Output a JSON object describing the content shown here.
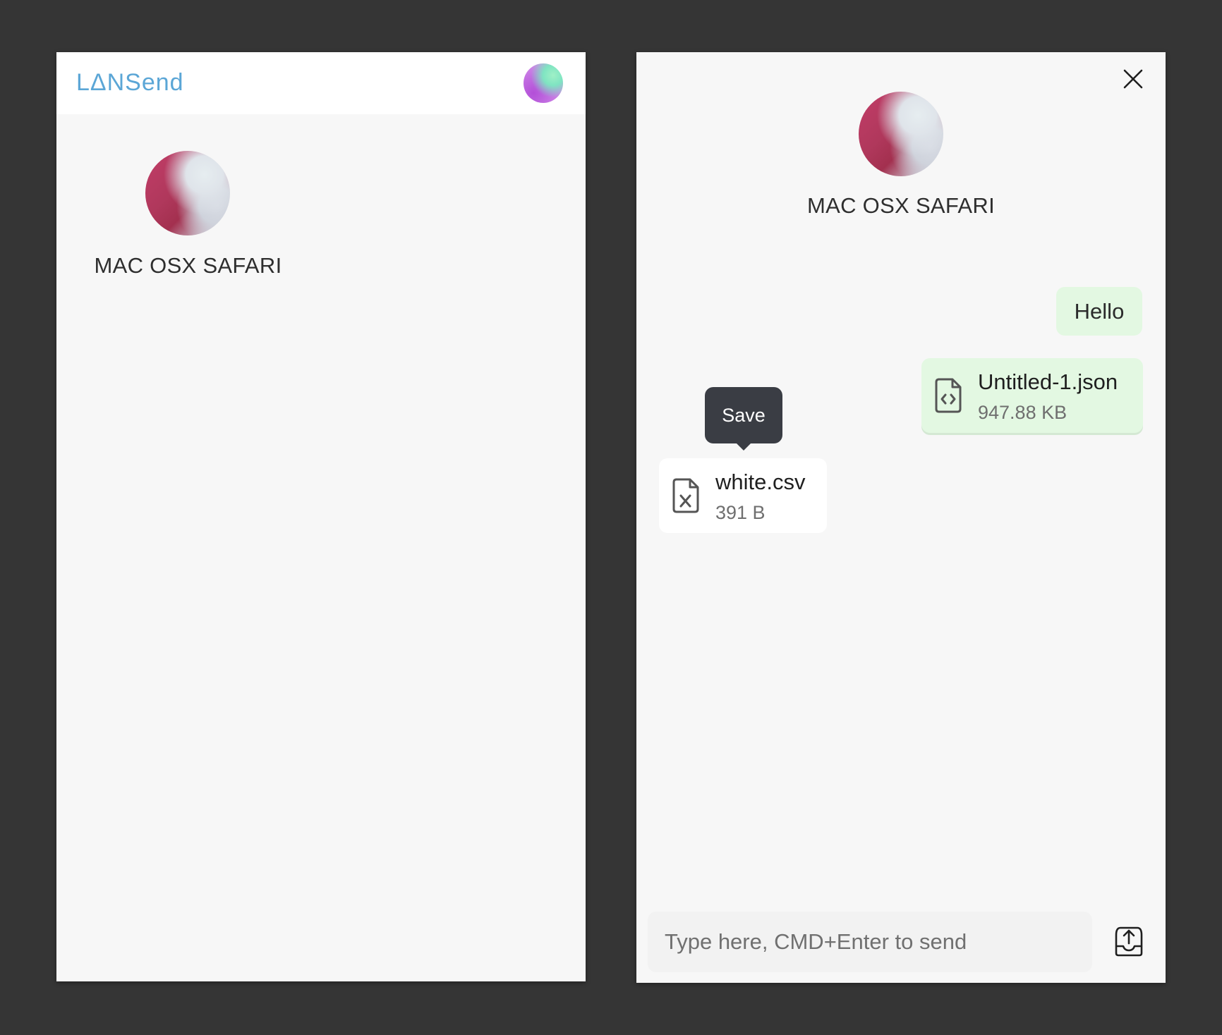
{
  "app": {
    "logo_text": "LΔNSend",
    "accent_color": "#5ba6d6"
  },
  "devices": [
    {
      "name": "MAC OSX SAFARI"
    }
  ],
  "chat": {
    "peer_name": "MAC OSX SAFARI",
    "messages": [
      {
        "type": "text",
        "direction": "sent",
        "text": "Hello"
      },
      {
        "type": "file",
        "direction": "sent",
        "file_name": "Untitled-1.json",
        "file_size": "947.88 KB",
        "icon": "file-code-icon"
      },
      {
        "type": "file",
        "direction": "received",
        "file_name": "white.csv",
        "file_size": "391 B",
        "icon": "file-excel-icon"
      }
    ],
    "tooltip": "Save",
    "input_placeholder": "Type here, CMD+Enter to send",
    "input_value": ""
  }
}
